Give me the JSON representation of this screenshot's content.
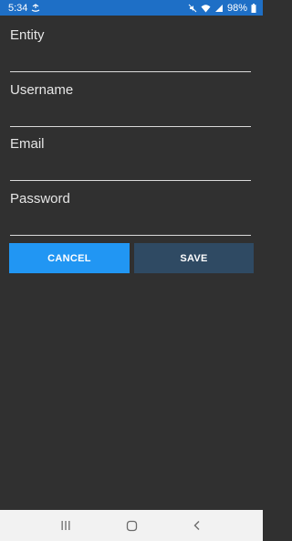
{
  "status_bar": {
    "time": "5:34",
    "battery": "98%",
    "icons": [
      "data-saver-icon",
      "mute-icon",
      "wifi-icon",
      "signal-icon",
      "battery-icon"
    ]
  },
  "form": {
    "fields": [
      {
        "label": "Entity",
        "value": "",
        "placeholder": ""
      },
      {
        "label": "Username",
        "value": "",
        "placeholder": ""
      },
      {
        "label": "Email",
        "value": "",
        "placeholder": ""
      },
      {
        "label": "Password",
        "value": "",
        "placeholder": ""
      }
    ]
  },
  "buttons": {
    "cancel": "CANCEL",
    "save": "SAVE"
  },
  "nav_bar": {
    "icons": [
      "recent-apps-icon",
      "home-icon",
      "back-icon"
    ]
  },
  "colors": {
    "status_bar": "#1e6fc6",
    "background": "#303030",
    "cancel_button": "#2196f3",
    "save_button": "#2f4a63",
    "nav_bar": "#f2f2f2"
  }
}
